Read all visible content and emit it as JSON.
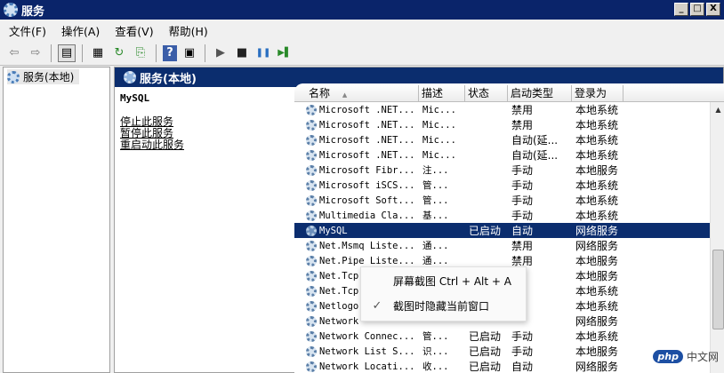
{
  "window": {
    "title": "服务",
    "min": "_",
    "max": "□",
    "close": "X"
  },
  "menu": [
    "文件(F)",
    "操作(A)",
    "查看(V)",
    "帮助(H)"
  ],
  "toolbar": {
    "icons": [
      "back-icon",
      "forward-icon",
      "console-tree-icon",
      "properties-icon",
      "refresh-icon",
      "export-icon",
      "help-icon",
      "view-icon",
      "start-icon",
      "stop-icon",
      "pause-icon",
      "restart-icon"
    ],
    "glyphs": {
      "back": "⇦",
      "forward": "⇨",
      "console": "▤",
      "props": "▦",
      "refresh": "↻",
      "export": "⎘",
      "help": "?",
      "view": "▣",
      "start": "▶",
      "stop": "■",
      "pause": "❚❚",
      "restart": "▶▌"
    }
  },
  "tree": {
    "root_label": "服务(本地)"
  },
  "pane": {
    "header": "服务(本地)",
    "selected_service": "MySQL",
    "links": [
      "停止此服务",
      "暂停此服务",
      "重启动此服务"
    ]
  },
  "list": {
    "columns": {
      "name": "名称",
      "sort": "▲",
      "desc": "描述",
      "status": "状态",
      "start": "启动类型",
      "logon": "登录为"
    },
    "rows": [
      {
        "name": "Microsoft .NET...",
        "desc": "Mic...",
        "status": "",
        "start": "禁用",
        "logon": "本地系统"
      },
      {
        "name": "Microsoft .NET...",
        "desc": "Mic...",
        "status": "",
        "start": "禁用",
        "logon": "本地系统"
      },
      {
        "name": "Microsoft .NET...",
        "desc": "Mic...",
        "status": "",
        "start": "自动(延...",
        "logon": "本地系统"
      },
      {
        "name": "Microsoft .NET...",
        "desc": "Mic...",
        "status": "",
        "start": "自动(延...",
        "logon": "本地系统"
      },
      {
        "name": "Microsoft Fibr...",
        "desc": "注...",
        "status": "",
        "start": "手动",
        "logon": "本地服务"
      },
      {
        "name": "Microsoft iSCS...",
        "desc": "管...",
        "status": "",
        "start": "手动",
        "logon": "本地系统"
      },
      {
        "name": "Microsoft Soft...",
        "desc": "管...",
        "status": "",
        "start": "手动",
        "logon": "本地系统"
      },
      {
        "name": "Multimedia Cla...",
        "desc": "基...",
        "status": "",
        "start": "手动",
        "logon": "本地系统"
      },
      {
        "name": "MySQL",
        "desc": "",
        "status": "已启动",
        "start": "自动",
        "logon": "网络服务"
      },
      {
        "name": "Net.Msmq Liste...",
        "desc": "通...",
        "status": "",
        "start": "禁用",
        "logon": "网络服务"
      },
      {
        "name": "Net.Pipe Liste...",
        "desc": "通...",
        "status": "",
        "start": "禁用",
        "logon": "本地服务"
      },
      {
        "name": "Net.Tcp",
        "desc": "",
        "status": "",
        "start": "",
        "logon": "本地服务"
      },
      {
        "name": "Net.Tcp",
        "desc": "",
        "status": "",
        "start": "",
        "logon": "本地系统"
      },
      {
        "name": "Netlogo",
        "desc": "",
        "status": "",
        "start": "",
        "logon": "本地系统"
      },
      {
        "name": "Network",
        "desc": "",
        "status": "",
        "start": "",
        "logon": "网络服务"
      },
      {
        "name": "Network Connec...",
        "desc": "管...",
        "status": "已启动",
        "start": "手动",
        "logon": "本地系统"
      },
      {
        "name": "Network List S...",
        "desc": "识...",
        "status": "已启动",
        "start": "手动",
        "logon": "本地服务"
      },
      {
        "name": "Network Locati...",
        "desc": "收...",
        "status": "已启动",
        "start": "自动",
        "logon": "网络服务"
      }
    ]
  },
  "popup": {
    "items": [
      {
        "label": "屏幕截图 Ctrl + Alt + A",
        "check": ""
      },
      {
        "label": "截图时隐藏当前窗口",
        "check": "✓"
      }
    ]
  },
  "watermark": {
    "logo": "php",
    "text": "中文网"
  },
  "colors": {
    "titlebar": "#0a246a",
    "selection": "#0b2d6e",
    "gear": "#4a7db8"
  }
}
